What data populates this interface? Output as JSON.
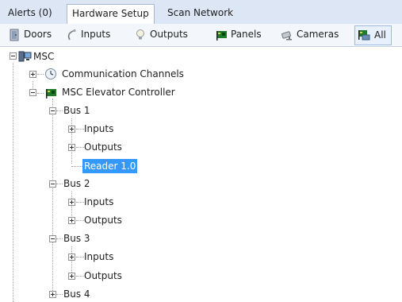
{
  "tabs": [
    {
      "label": "Alerts (0)",
      "active": false
    },
    {
      "label": "Hardware Setup",
      "active": true
    },
    {
      "label": "Scan Network",
      "active": false
    }
  ],
  "toolbar": {
    "doors": "Doors",
    "inputs": "Inputs",
    "outputs": "Outputs",
    "panels": "Panels",
    "cameras": "Cameras",
    "all": "All",
    "active": "All"
  },
  "tree": {
    "root": "MSC",
    "comm_channels": "Communication Channels",
    "controller": "MSC Elevator Controller",
    "bus1": {
      "label": "Bus 1",
      "inputs": "Inputs",
      "outputs": "Outputs",
      "reader": "Reader 1.0"
    },
    "bus2": {
      "label": "Bus 2",
      "inputs": "Inputs",
      "outputs": "Outputs"
    },
    "bus3": {
      "label": "Bus 3",
      "inputs": "Inputs",
      "outputs": "Outputs"
    },
    "bus4": {
      "label": "Bus 4"
    },
    "selected": "Reader 1.0"
  },
  "colors": {
    "tab_strip_bg": "#dce6f4",
    "selection": "#3399ff",
    "toolbar_bg": "#f3f6fb"
  }
}
